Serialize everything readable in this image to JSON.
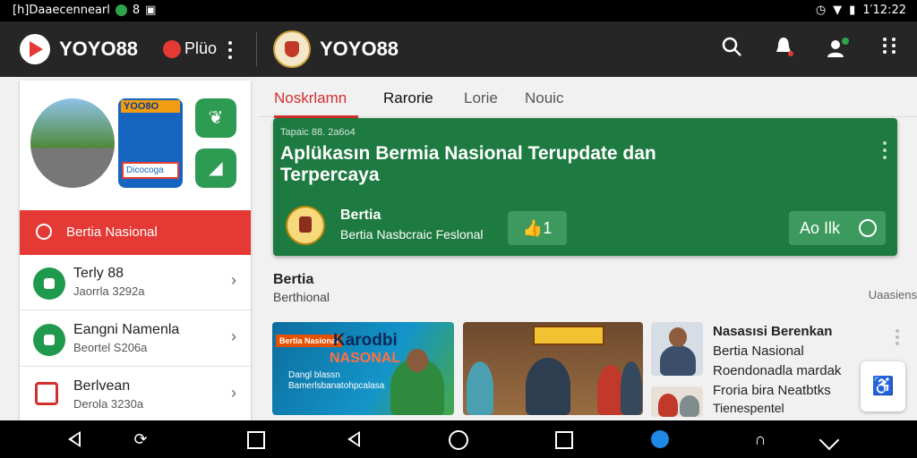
{
  "status_bar": {
    "left_text": "[h]Daaecennearl",
    "time": "1′12:22"
  },
  "app_bar": {
    "store_title": "YOYO88",
    "plus_label": "Plüo",
    "app_title": "YOYO88",
    "icons": [
      "play-store-logo",
      "more-vert-icon",
      "app-emblem",
      "search-icon",
      "notification-bell-icon",
      "add-person-icon",
      "apps-grid-icon"
    ]
  },
  "left_panel": {
    "promo_banner_label": "YOO8O",
    "promo_banner_sub": "Dicocoga",
    "active_item": "Bertia Nasional",
    "items": [
      {
        "title": "Terly 88",
        "subtitle": "Jaorrla 3292a"
      },
      {
        "title": "Eangni Namenla",
        "subtitle": "Beortel S206a"
      },
      {
        "title": "Berlvean",
        "subtitle": "Derola 3230a"
      }
    ]
  },
  "tabs": [
    "Noskrlamn",
    "Rarorie",
    "Lorie",
    "Nouic"
  ],
  "hero": {
    "meta": "Tapaic 88. 2a6o4",
    "headline": "Aplükasın Bermia Nasional Terupdate dan Terpercaya",
    "brand_title": "Bertia",
    "brand_subtitle": "Bertia Nasbcraic Feslonal",
    "like_count": "1",
    "action_label": "Ao Ilk"
  },
  "section": {
    "title": "Bertia",
    "subtitle": "Berthional",
    "see_all": "Uaasiens"
  },
  "news_cards": {
    "card1_tag": "Bertia Nasional",
    "card1_title": "Karodbi",
    "card1_title2": "NASONAL",
    "card1_text": "Dangl blassn Bamerlsbanatohpcalasa"
  },
  "side_news": {
    "title": "Nasasısi Berenkan",
    "lines": [
      "Bertia Nasional",
      "Roendonadla mardak",
      "Froria bira Neatbtks",
      "Tienespentel"
    ]
  },
  "colors": {
    "accent_red": "#e53935",
    "brand_green": "#1d7a40",
    "app_bar": "#262626"
  }
}
